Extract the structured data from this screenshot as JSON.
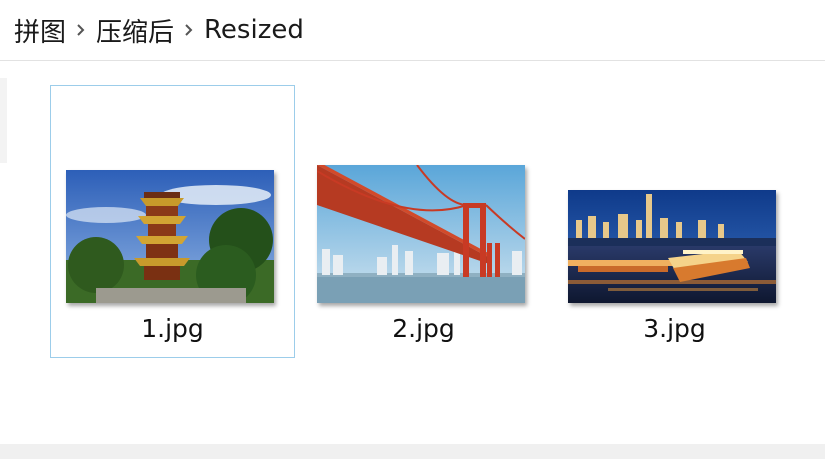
{
  "breadcrumb": {
    "items": [
      "拼图",
      "压缩后",
      "Resized"
    ]
  },
  "files": [
    {
      "name": "1.jpg",
      "selected": true,
      "thumbnail": "yellow-crane-tower-photo"
    },
    {
      "name": "2.jpg",
      "selected": false,
      "thumbnail": "red-suspension-bridge-photo"
    },
    {
      "name": "3.jpg",
      "selected": false,
      "thumbnail": "river-night-cityscape-photo"
    }
  ],
  "colors": {
    "selection_border": "#9ccdea",
    "text": "#1a1a1a"
  }
}
